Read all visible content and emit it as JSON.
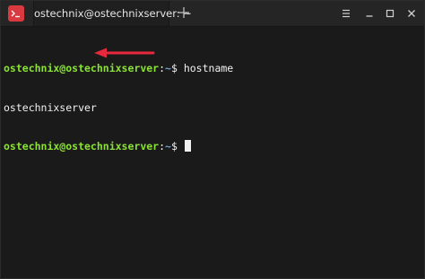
{
  "window": {
    "tab_title": "ostechnix@ostechnixserver: ~",
    "new_tab_icon": "plus-icon",
    "buttons": [
      "menu-icon",
      "minimize-icon",
      "maximize-icon",
      "close-icon"
    ]
  },
  "terminal": {
    "lines": [
      {
        "user": "ostechnix@ostechnixserver",
        "sep": ":",
        "path": "~",
        "prompt": "$ ",
        "command": "hostname"
      },
      {
        "output": "ostechnixserver"
      },
      {
        "user": "ostechnix@ostechnixserver",
        "sep": ":",
        "path": "~",
        "prompt": "$ ",
        "command": ""
      }
    ]
  },
  "colors": {
    "user": "#8ae234",
    "path": "#729fcf",
    "arrow": "#e8283c",
    "background": "#1a1a1a"
  }
}
